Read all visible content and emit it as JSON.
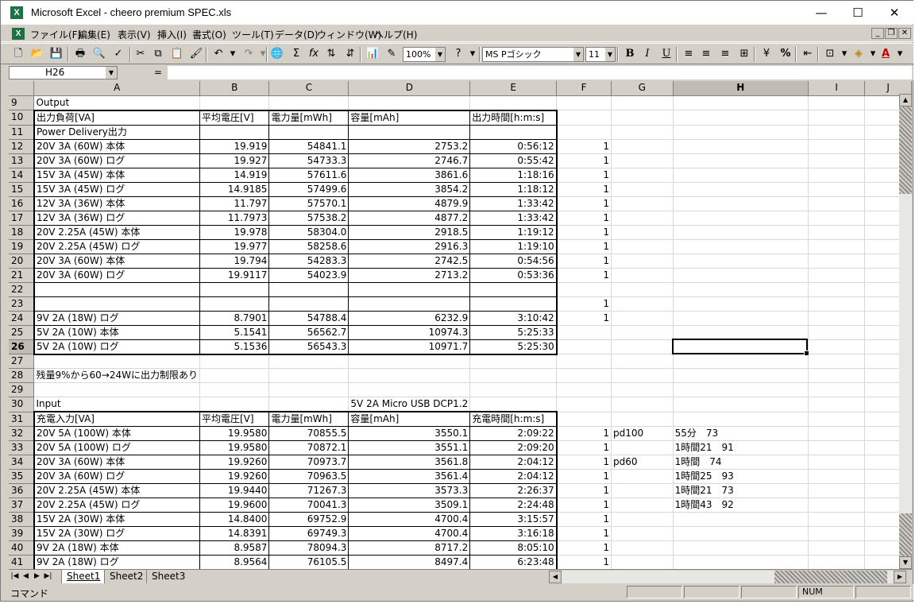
{
  "window": {
    "title": "Microsoft Excel - cheero premium SPEC.xls",
    "minimize_icon": "minimize-icon",
    "maximize_icon": "maximize-icon",
    "close_icon": "close-icon"
  },
  "menu": {
    "items": [
      "ファイル(F)",
      "編集(E)",
      "表示(V)",
      "挿入(I)",
      "書式(O)",
      "ツール(T)",
      "データ(D)",
      "ウィンドウ(W)",
      "ヘルプ(H)"
    ]
  },
  "toolbar": {
    "zoom": "100%",
    "font_name": "MS Pゴシック",
    "font_size": "11",
    "bold": "B",
    "italic": "I",
    "underline": "U",
    "percent": "%"
  },
  "formula_bar": {
    "name_box": "H26",
    "equals": "=",
    "content": ""
  },
  "columns": [
    "A",
    "B",
    "C",
    "D",
    "E",
    "F",
    "G",
    "H",
    "I",
    "J"
  ],
  "selected_cell": "H26",
  "rows": [
    {
      "n": "9",
      "A": "Output",
      "B": "",
      "C": "",
      "D": "",
      "E": "",
      "F": "",
      "G": "",
      "H": ""
    },
    {
      "n": "10",
      "A": "出力負荷[VA]",
      "B": "平均電圧[V]",
      "C": "電力量[mWh]",
      "D": "容量[mAh]",
      "E": "出力時間[h:m:s]",
      "F": "",
      "G": "",
      "H": ""
    },
    {
      "n": "11",
      "A": "Power Delivery出力",
      "B": "",
      "C": "",
      "D": "",
      "E": "",
      "F": "",
      "G": "",
      "H": ""
    },
    {
      "n": "12",
      "A": "20V 3A (60W) 本体",
      "B": "19.919",
      "C": "54841.1",
      "D": "2753.2",
      "E": "0:56:12",
      "F": "1",
      "G": "",
      "H": ""
    },
    {
      "n": "13",
      "A": "20V 3A (60W) ログ",
      "B": "19.927",
      "C": "54733.3",
      "D": "2746.7",
      "E": "0:55:42",
      "F": "1",
      "G": "",
      "H": ""
    },
    {
      "n": "14",
      "A": "15V 3A (45W) 本体",
      "B": "14.919",
      "C": "57611.6",
      "D": "3861.6",
      "E": "1:18:16",
      "F": "1",
      "G": "",
      "H": ""
    },
    {
      "n": "15",
      "A": "15V 3A (45W) ログ",
      "B": "14.9185",
      "C": "57499.6",
      "D": "3854.2",
      "E": "1:18:12",
      "F": "1",
      "G": "",
      "H": ""
    },
    {
      "n": "16",
      "A": "12V 3A (36W) 本体",
      "B": "11.797",
      "C": "57570.1",
      "D": "4879.9",
      "E": "1:33:42",
      "F": "1",
      "G": "",
      "H": ""
    },
    {
      "n": "17",
      "A": "12V 3A (36W) ログ",
      "B": "11.7973",
      "C": "57538.2",
      "D": "4877.2",
      "E": "1:33:42",
      "F": "1",
      "G": "",
      "H": ""
    },
    {
      "n": "18",
      "A": "20V 2.25A (45W) 本体",
      "B": "19.978",
      "C": "58304.0",
      "D": "2918.5",
      "E": "1:19:12",
      "F": "1",
      "G": "",
      "H": ""
    },
    {
      "n": "19",
      "A": "20V 2.25A (45W) ログ",
      "B": "19.977",
      "C": "58258.6",
      "D": "2916.3",
      "E": "1:19:10",
      "F": "1",
      "G": "",
      "H": ""
    },
    {
      "n": "20",
      "A": "20V 3A (60W) 本体",
      "B": "19.794",
      "C": "54283.3",
      "D": "2742.5",
      "E": "0:54:56",
      "F": "1",
      "G": "",
      "H": ""
    },
    {
      "n": "21",
      "A": "20V 3A (60W) ログ",
      "B": "19.9117",
      "C": "54023.9",
      "D": "2713.2",
      "E": "0:53:36",
      "F": "1",
      "G": "",
      "H": ""
    },
    {
      "n": "22",
      "A": "",
      "B": "",
      "C": "",
      "D": "",
      "E": "",
      "F": "",
      "G": "",
      "H": ""
    },
    {
      "n": "23",
      "A": "",
      "B": "",
      "C": "",
      "D": "",
      "E": "",
      "F": "1",
      "G": "",
      "H": ""
    },
    {
      "n": "24",
      "A": "9V 2A (18W) ログ",
      "B": "8.7901",
      "C": "54788.4",
      "D": "6232.9",
      "E": "3:10:42",
      "F": "1",
      "G": "",
      "H": ""
    },
    {
      "n": "25",
      "A": "5V 2A (10W) 本体",
      "B": "5.1541",
      "C": "56562.7",
      "D": "10974.3",
      "E": "5:25:33",
      "F": "",
      "G": "",
      "H": ""
    },
    {
      "n": "26",
      "A": "5V 2A (10W) ログ",
      "B": "5.1536",
      "C": "56543.3",
      "D": "10971.7",
      "E": "5:25:30",
      "F": "",
      "G": "",
      "H": ""
    },
    {
      "n": "27",
      "A": "",
      "B": "",
      "C": "",
      "D": "",
      "E": "",
      "F": "",
      "G": "",
      "H": ""
    },
    {
      "n": "28",
      "A": "残量9%から60→24Wに出力制限あり",
      "B": "",
      "C": "",
      "D": "",
      "E": "",
      "F": "",
      "G": "",
      "H": ""
    },
    {
      "n": "29",
      "A": "",
      "B": "",
      "C": "",
      "D": "",
      "E": "",
      "F": "",
      "G": "",
      "H": ""
    },
    {
      "n": "30",
      "A": "Input",
      "B": "",
      "C": "",
      "D": "5V 2A Micro USB DCP1.2",
      "E": "",
      "F": "",
      "G": "",
      "H": ""
    },
    {
      "n": "31",
      "A": "充電入力[VA]",
      "B": "平均電圧[V]",
      "C": "電力量[mWh]",
      "D": "容量[mAh]",
      "E": "充電時間[h:m:s]",
      "F": "",
      "G": "",
      "H": ""
    },
    {
      "n": "32",
      "A": "20V 5A (100W) 本体",
      "B": "19.9580",
      "C": "70855.5",
      "D": "3550.1",
      "E": "2:09:22",
      "F": "1",
      "G": "pd100",
      "H": "55分　73"
    },
    {
      "n": "33",
      "A": "20V 5A (100W) ログ",
      "B": "19.9580",
      "C": "70872.1",
      "D": "3551.1",
      "E": "2:09:20",
      "F": "1",
      "G": "",
      "H": "1時間21　91"
    },
    {
      "n": "34",
      "A": "20V 3A (60W) 本体",
      "B": "19.9260",
      "C": "70973.7",
      "D": "3561.8",
      "E": "2:04:12",
      "F": "1",
      "G": "pd60",
      "H": "1時間　74"
    },
    {
      "n": "35",
      "A": "20V 3A (60W) ログ",
      "B": "19.9260",
      "C": "70963.5",
      "D": "3561.4",
      "E": "2:04:12",
      "F": "1",
      "G": "",
      "H": "1時間25　93"
    },
    {
      "n": "36",
      "A": "20V 2.25A (45W) 本体",
      "B": "19.9440",
      "C": "71267.3",
      "D": "3573.3",
      "E": "2:26:37",
      "F": "1",
      "G": "",
      "H": "1時間21　73"
    },
    {
      "n": "37",
      "A": "20V 2.25A (45W) ログ",
      "B": "19.9600",
      "C": "70041.3",
      "D": "3509.1",
      "E": "2:24:48",
      "F": "1",
      "G": "",
      "H": "1時間43　92"
    },
    {
      "n": "38",
      "A": "15V 2A (30W) 本体",
      "B": "14.8400",
      "C": "69752.9",
      "D": "4700.4",
      "E": "3:15:57",
      "F": "1",
      "G": "",
      "H": ""
    },
    {
      "n": "39",
      "A": "15V 2A (30W) ログ",
      "B": "14.8391",
      "C": "69749.3",
      "D": "4700.4",
      "E": "3:16:18",
      "F": "1",
      "G": "",
      "H": ""
    },
    {
      "n": "40",
      "A": "9V 2A (18W) 本体",
      "B": "8.9587",
      "C": "78094.3",
      "D": "8717.2",
      "E": "8:05:10",
      "F": "1",
      "G": "",
      "H": ""
    },
    {
      "n": "41",
      "A": "9V 2A (18W) ログ",
      "B": "8.9564",
      "C": "76105.5",
      "D": "8497.4",
      "E": "6:23:48",
      "F": "1",
      "G": "",
      "H": ""
    }
  ],
  "sheet_tabs": [
    "Sheet1",
    "Sheet2",
    "Sheet3"
  ],
  "active_sheet": "Sheet1",
  "status": {
    "mode": "コマンド",
    "num": "NUM"
  }
}
